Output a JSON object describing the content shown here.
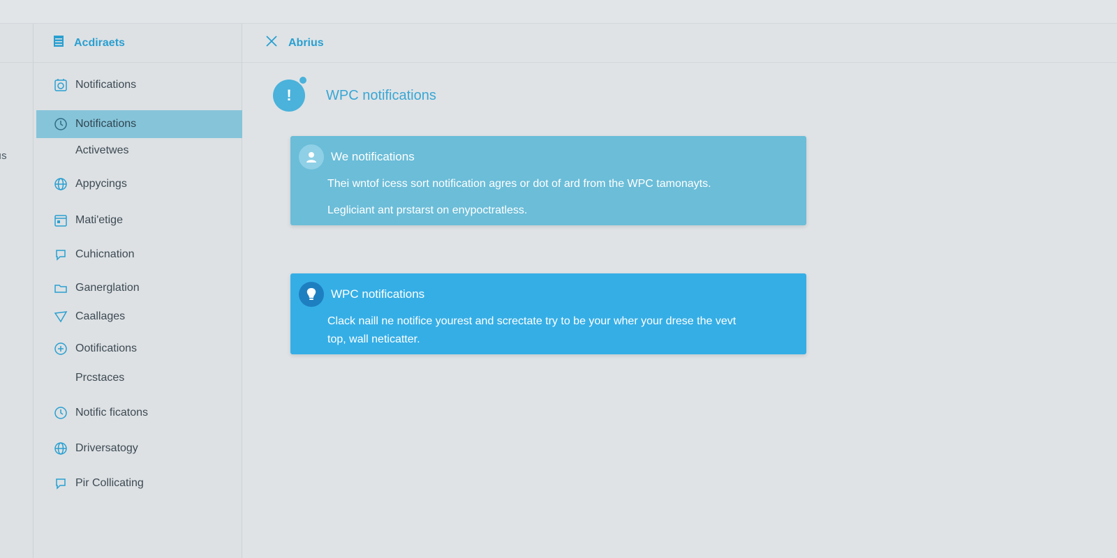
{
  "rail": {
    "partial_label": "ıs"
  },
  "sidebar": {
    "header_title": "Acdiraets",
    "items": [
      {
        "label": "Notifications",
        "icon": "bell-icon"
      },
      {
        "label": "Notifications",
        "icon": "clock-icon",
        "active": true
      },
      {
        "label": "Activetwes",
        "icon": ""
      },
      {
        "label": "Appycings",
        "icon": "globe-icon"
      },
      {
        "label": "Mati'etige",
        "icon": "calendar-icon"
      },
      {
        "label": "Cuhicnation",
        "icon": "chat-icon"
      },
      {
        "label": "Ganerglation",
        "icon": "folder-icon"
      },
      {
        "label": "Caallages",
        "icon": "shield-icon"
      },
      {
        "label": "Ootifications",
        "icon": "plus-circle-icon"
      },
      {
        "label": "Prcstaces",
        "icon": ""
      },
      {
        "label": "Notific ficatons",
        "icon": "clock-icon"
      },
      {
        "label": "Driversatogy",
        "icon": "globe-icon"
      },
      {
        "label": "Pir Collicating",
        "icon": "chat-icon"
      }
    ]
  },
  "main": {
    "header_title": "Abrius",
    "heading": "WPC notifications",
    "cards": [
      {
        "title": "We notifications",
        "lines": [
          "Thei wntof icess sort notification agres or dot of ard from the WPC tamonayts.",
          "Legliciant ant prstarst on enypoctratless."
        ]
      },
      {
        "title": "WPC notifications",
        "lines": [
          "Clack naill ne notifice yourest and screctate try to be your wher your drese the vevt",
          "top, wall neticatter."
        ]
      }
    ]
  },
  "colors": {
    "accent": "#2a9fd0",
    "active_item": "#86c4d9",
    "card_light": "#6bbdd8",
    "card_strong": "#35aee6"
  }
}
